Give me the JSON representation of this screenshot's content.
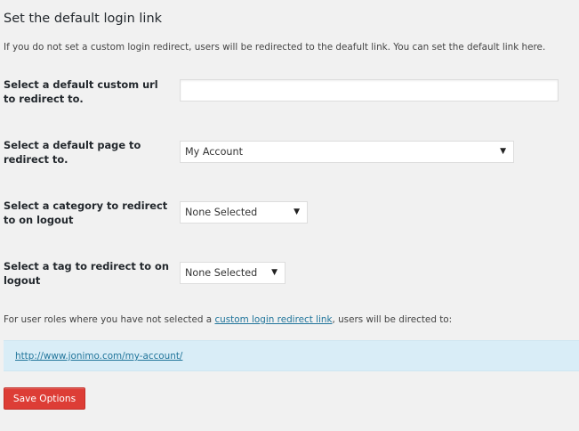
{
  "section": {
    "title": "Set the default login link",
    "description": "If you do not set a custom login redirect, users will be redirected to the deafult link. You can set the default link here."
  },
  "fields": {
    "custom_url": {
      "label": "Select a default custom url to redirect to.",
      "value": "",
      "placeholder": ""
    },
    "default_page": {
      "label": "Select a default page to redirect to.",
      "selected": "My Account"
    },
    "logout_category": {
      "label": "Select a category to redirect to on logout",
      "selected": "None Selected"
    },
    "logout_tag": {
      "label": "Select a tag to redirect to on logout",
      "selected": "None Selected"
    }
  },
  "note": {
    "prefix": "For user roles where you have not selected a ",
    "link_text": "custom login redirect link",
    "suffix": ", users will be directed to:"
  },
  "default_link": {
    "url": "http://www.jonimo.com/my-account/"
  },
  "buttons": {
    "save_label": "Save Options"
  },
  "icons": {
    "select_arrow": "▼"
  },
  "colors": {
    "save_button": "#dd3d36",
    "link": "#21759b",
    "info_box": "#d9edf7",
    "background": "#f1f1f1"
  }
}
